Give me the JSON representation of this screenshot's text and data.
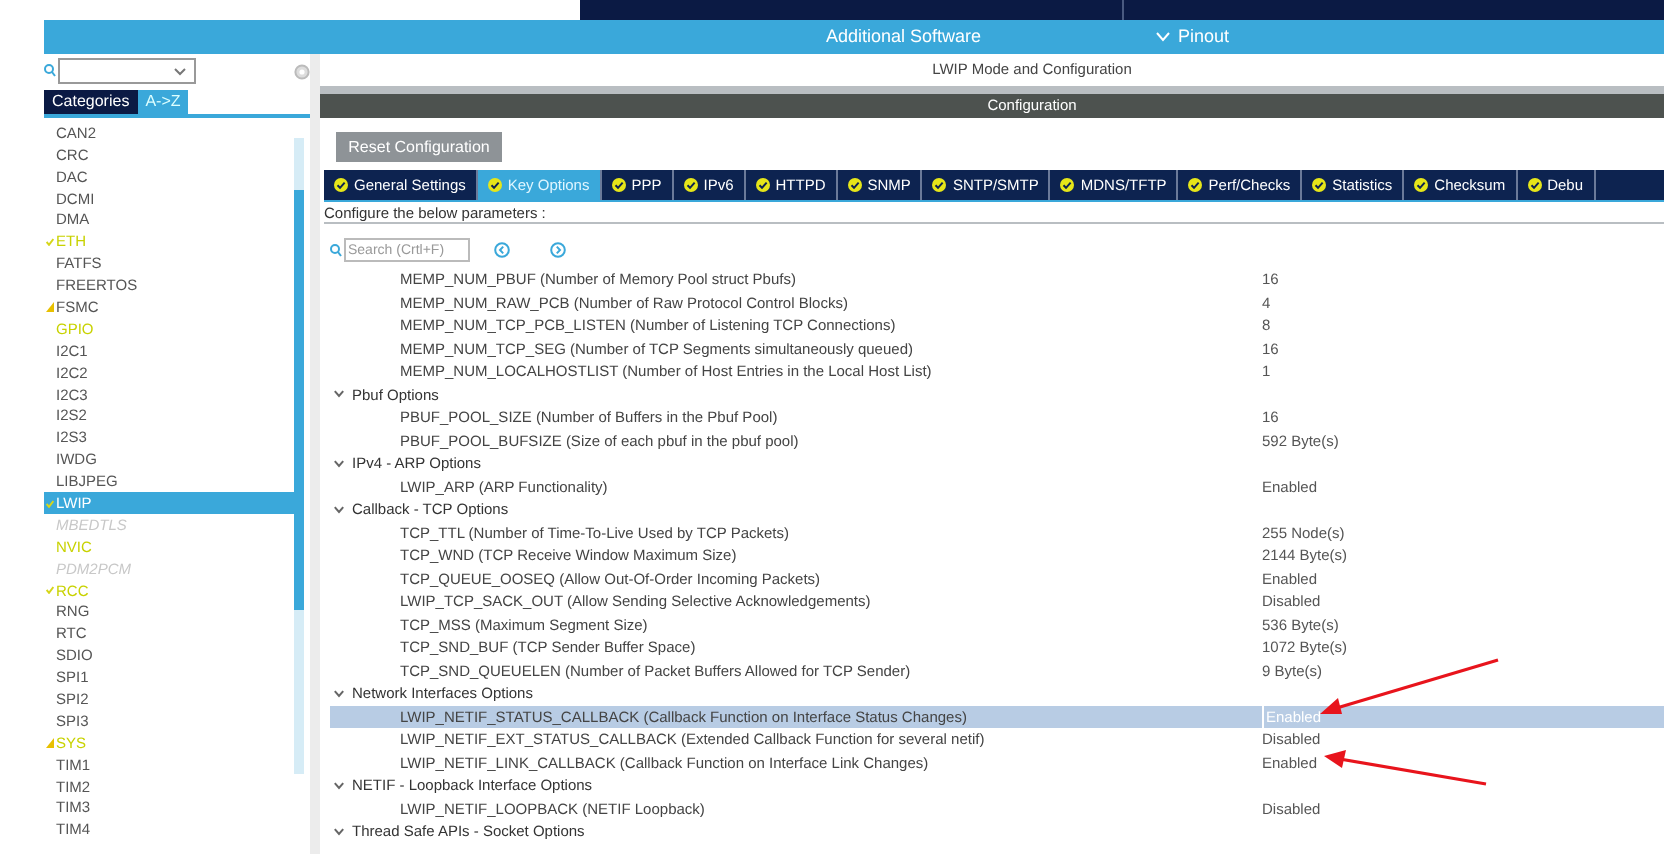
{
  "top_bar": {
    "items": [
      {
        "label": "Additional Software",
        "kind": "text"
      },
      {
        "label": "Pinout",
        "kind": "dropdown"
      }
    ]
  },
  "sidebar": {
    "tabs": [
      {
        "label": "Categories",
        "selected": false
      },
      {
        "label": "A->Z",
        "selected": true
      }
    ],
    "items": [
      {
        "label": "CAN2",
        "checked": false,
        "warning": false,
        "configured": false,
        "selected": false
      },
      {
        "label": "CRC",
        "checked": false,
        "warning": false,
        "configured": false,
        "selected": false
      },
      {
        "label": "DAC",
        "checked": false,
        "warning": false,
        "configured": false,
        "selected": false
      },
      {
        "label": "DCMI",
        "checked": false,
        "warning": false,
        "configured": false,
        "selected": false
      },
      {
        "label": "DMA",
        "checked": false,
        "warning": false,
        "configured": false,
        "selected": false
      },
      {
        "label": "ETH",
        "checked": true,
        "warning": false,
        "configured": true,
        "selected": false
      },
      {
        "label": "FATFS",
        "checked": false,
        "warning": false,
        "configured": false,
        "selected": false
      },
      {
        "label": "FREERTOS",
        "checked": false,
        "warning": false,
        "configured": false,
        "selected": false
      },
      {
        "label": "FSMC",
        "checked": false,
        "warning": true,
        "configured": false,
        "selected": false
      },
      {
        "label": "GPIO",
        "checked": false,
        "warning": false,
        "configured": true,
        "selected": false
      },
      {
        "label": "I2C1",
        "checked": false,
        "warning": false,
        "configured": false,
        "selected": false
      },
      {
        "label": "I2C2",
        "checked": false,
        "warning": false,
        "configured": false,
        "selected": false
      },
      {
        "label": "I2C3",
        "checked": false,
        "warning": false,
        "configured": false,
        "selected": false
      },
      {
        "label": "I2S2",
        "checked": false,
        "warning": false,
        "configured": false,
        "selected": false
      },
      {
        "label": "I2S3",
        "checked": false,
        "warning": false,
        "configured": false,
        "selected": false
      },
      {
        "label": "IWDG",
        "checked": false,
        "warning": false,
        "configured": false,
        "selected": false
      },
      {
        "label": "LIBJPEG",
        "checked": false,
        "warning": false,
        "configured": false,
        "selected": false
      },
      {
        "label": "LWIP",
        "checked": true,
        "warning": false,
        "selected": true
      },
      {
        "label": "MBEDTLS",
        "checked": false,
        "warning": false,
        "disabled": true,
        "selected": false
      },
      {
        "label": "NVIC",
        "checked": false,
        "warning": false,
        "configured": true,
        "selected": false
      },
      {
        "label": "PDM2PCM",
        "checked": false,
        "warning": false,
        "disabled": true,
        "selected": false
      },
      {
        "label": "RCC",
        "checked": true,
        "warning": false,
        "configured": true,
        "selected": false
      },
      {
        "label": "RNG",
        "checked": false,
        "warning": false,
        "configured": false,
        "selected": false
      },
      {
        "label": "RTC",
        "checked": false,
        "warning": false,
        "configured": false,
        "selected": false
      },
      {
        "label": "SDIO",
        "checked": false,
        "warning": false,
        "configured": false,
        "selected": false
      },
      {
        "label": "SPI1",
        "checked": false,
        "warning": false,
        "configured": false,
        "selected": false
      },
      {
        "label": "SPI2",
        "checked": false,
        "warning": false,
        "configured": false,
        "selected": false
      },
      {
        "label": "SPI3",
        "checked": false,
        "warning": false,
        "configured": false,
        "selected": false
      },
      {
        "label": "SYS",
        "checked": false,
        "warning": true,
        "configured": true,
        "selected": false
      },
      {
        "label": "TIM1",
        "checked": false,
        "warning": false,
        "configured": false,
        "selected": false
      },
      {
        "label": "TIM2",
        "checked": false,
        "warning": false,
        "configured": false,
        "selected": false
      },
      {
        "label": "TIM3",
        "checked": false,
        "warning": false,
        "configured": false,
        "selected": false
      },
      {
        "label": "TIM4",
        "checked": false,
        "warning": false,
        "configured": false,
        "selected": false
      }
    ]
  },
  "main": {
    "mode_title": "LWIP Mode and Configuration",
    "config_title": "Configuration",
    "reset_button": "Reset Configuration",
    "tabs": [
      {
        "label": "General Settings",
        "selected": false
      },
      {
        "label": "Key Options",
        "selected": true
      },
      {
        "label": "PPP",
        "selected": false
      },
      {
        "label": "IPv6",
        "selected": false
      },
      {
        "label": "HTTPD",
        "selected": false
      },
      {
        "label": "SNMP",
        "selected": false
      },
      {
        "label": "SNTP/SMTP",
        "selected": false
      },
      {
        "label": "MDNS/TFTP",
        "selected": false
      },
      {
        "label": "Perf/Checks",
        "selected": false
      },
      {
        "label": "Statistics",
        "selected": false
      },
      {
        "label": "Checksum",
        "selected": false
      },
      {
        "label": "Debu",
        "selected": false
      }
    ],
    "hint": "Configure the below parameters :",
    "search": {
      "placeholder": "Search (Crtl+F)"
    },
    "groups": [
      {
        "children": [
          {
            "name": "MEMP_NUM_PBUF (Number of Memory Pool struct Pbufs)",
            "value": "16",
            "selected": false,
            "arrow": false
          },
          {
            "name": "MEMP_NUM_RAW_PCB (Number of Raw Protocol Control Blocks)",
            "value": "4",
            "selected": false,
            "arrow": false
          },
          {
            "name": "MEMP_NUM_TCP_PCB_LISTEN (Number of Listening TCP Connections)",
            "value": "8",
            "selected": false,
            "arrow": false
          },
          {
            "name": "MEMP_NUM_TCP_SEG (Number of TCP Segments simultaneously queued)",
            "value": "16",
            "selected": false,
            "arrow": false
          },
          {
            "name": "MEMP_NUM_LOCALHOSTLIST (Number of Host Entries in the Local Host List)",
            "value": "1",
            "selected": false,
            "arrow": false
          }
        ]
      },
      {
        "title": "Pbuf Options",
        "children": [
          {
            "name": "PBUF_POOL_SIZE (Number of Buffers in the Pbuf Pool)",
            "value": "16",
            "selected": false,
            "arrow": false
          },
          {
            "name": "PBUF_POOL_BUFSIZE (Size of each pbuf in the pbuf pool)",
            "value": "592 Byte(s)",
            "selected": false,
            "arrow": false
          }
        ]
      },
      {
        "title": "IPv4 - ARP Options",
        "children": [
          {
            "name": "LWIP_ARP (ARP Functionality)",
            "value": "Enabled",
            "selected": false,
            "arrow": false
          }
        ]
      },
      {
        "title": "Callback - TCP Options",
        "children": [
          {
            "name": "TCP_TTL (Number of Time-To-Live Used by TCP Packets)",
            "value": "255 Node(s)",
            "selected": false,
            "arrow": false
          },
          {
            "name": "TCP_WND (TCP Receive Window Maximum Size)",
            "value": "2144 Byte(s)",
            "selected": false,
            "arrow": false
          },
          {
            "name": "TCP_QUEUE_OOSEQ (Allow Out-Of-Order Incoming Packets)",
            "value": "Enabled",
            "selected": false,
            "arrow": false
          },
          {
            "name": "LWIP_TCP_SACK_OUT (Allow Sending Selective Acknowledgements)",
            "value": "Disabled",
            "selected": false,
            "arrow": false
          },
          {
            "name": "TCP_MSS (Maximum Segment Size)",
            "value": "536 Byte(s)",
            "selected": false,
            "arrow": false
          },
          {
            "name": "TCP_SND_BUF (TCP Sender Buffer Space)",
            "value": "1072 Byte(s)",
            "selected": false,
            "arrow": false
          },
          {
            "name": "TCP_SND_QUEUELEN (Number of Packet Buffers Allowed for TCP Sender)",
            "value": "9 Byte(s)",
            "selected": false,
            "arrow": false
          }
        ]
      },
      {
        "title": "Network Interfaces Options",
        "children": [
          {
            "name": "LWIP_NETIF_STATUS_CALLBACK (Callback Function on Interface Status Changes)",
            "value": "Enabled",
            "selected": true,
            "arrow": true
          },
          {
            "name": "LWIP_NETIF_EXT_STATUS_CALLBACK (Extended Callback Function for several netif)",
            "value": "Disabled",
            "selected": false,
            "arrow": false
          },
          {
            "name": "LWIP_NETIF_LINK_CALLBACK (Callback Function on Interface Link Changes)",
            "value": "Enabled",
            "selected": false,
            "arrow": true
          }
        ]
      },
      {
        "title": "NETIF - Loopback Interface Options",
        "children": [
          {
            "name": "LWIP_NETIF_LOOPBACK (NETIF Loopback)",
            "value": "Disabled",
            "selected": false,
            "arrow": false
          }
        ]
      },
      {
        "title": "Thread Safe APIs - Socket Options"
      }
    ]
  }
}
